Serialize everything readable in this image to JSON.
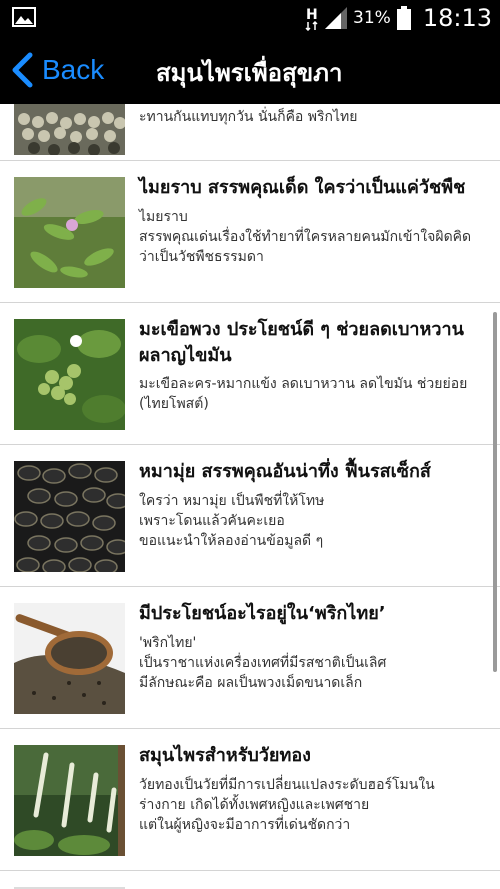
{
  "status_bar": {
    "network": "H",
    "battery_percent": "31%",
    "time": "18:13"
  },
  "header": {
    "back_label": "Back",
    "title": "สมุนไพรเพื่อสุขภา"
  },
  "partial_top": {
    "description": "ะทานกันแทบทุกวัน นั่นก็คือ พริกไทย"
  },
  "items": [
    {
      "title": "ไมยราบ สรรพคุณเด็ด ใครว่าเป็นแค่วัชพืช",
      "description": "ไมยราบ\nสรรพคุณเด่นเรื่องใช้ทำยาที่ใครหลายคนมักเข้าใจผิดคิดว่าเป็นวัชพืชธรรมดา"
    },
    {
      "title": "มะเขือพวง ประโยชน์ดี ๆ ช่วยลดเบาหวาน ผลาญไขมัน",
      "description": "มะเขือละคร-หมากแข้ง ลดเบาหวาน ลดไขมัน ช่วยย่อย (ไทยโพสต์)"
    },
    {
      "title": "หมามุ่ย สรรพคุณอันน่าทึ่ง ฟื้นรสเซ็กส์",
      "description": "ใครว่า หมามุ่ย เป็นพืชที่ให้โทษ\nเพราะโดนแล้วคันคะเยอ\nขอแนะนำให้ลองอ่านข้อมูลดี ๆ"
    },
    {
      "title": "มีประโยชน์อะไรอยู่ใน‘พริกไทย’",
      "description": "'พริกไทย'\nเป็นราชาแห่งเครื่องเทศที่มีรสชาติเป็นเลิศ\nมีลักษณะคือ ผลเป็นพวงเม็ดขนาดเล็ก"
    },
    {
      "title": "สมุนไพรสำหรับวัยทอง",
      "description": "วัยทองเป็นวัยที่มีการเปลี่ยนแปลงระดับฮอร์โมนในร่างกาย เกิดได้ทั้งเพศหญิงและเพศชาย\nแต่ในผู้หญิงจะมีอาการที่เด่นชัดกว่า"
    }
  ]
}
